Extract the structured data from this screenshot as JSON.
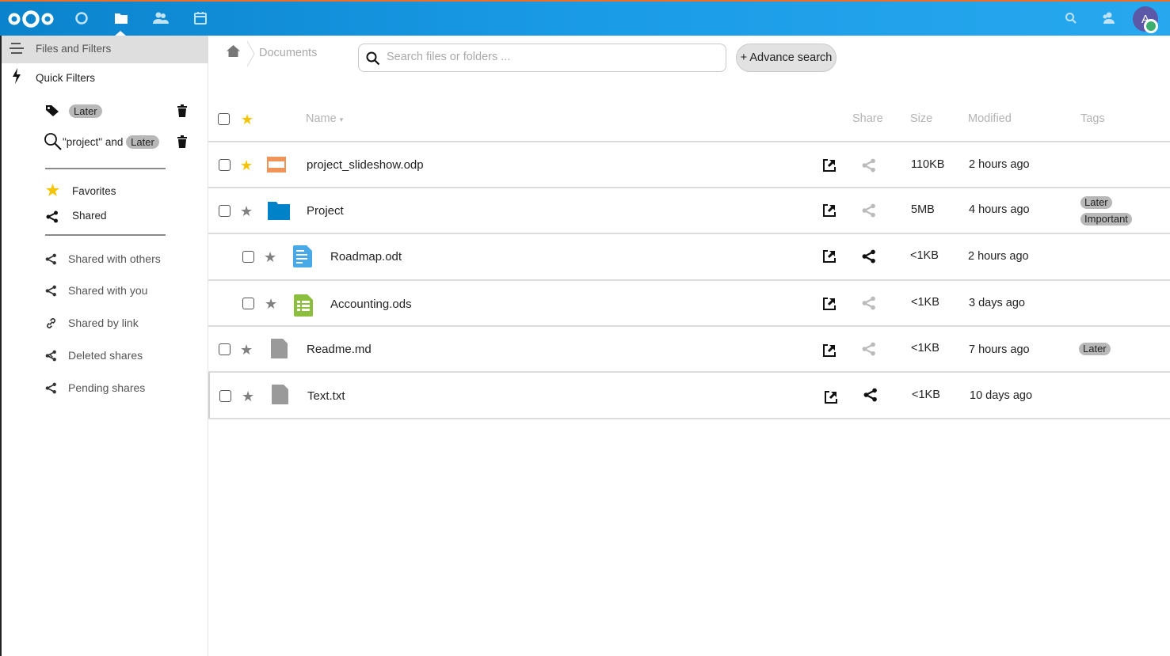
{
  "topbar": {
    "nav": [
      {
        "name": "dashboard",
        "icon": "circle-icon"
      },
      {
        "name": "files",
        "icon": "folder-icon",
        "active": true
      },
      {
        "name": "contacts",
        "icon": "contacts-icon"
      },
      {
        "name": "calendar",
        "icon": "calendar-icon"
      }
    ],
    "right": {
      "search_icon": "search-icon",
      "contacts_icon": "contacts-icon"
    },
    "avatar": {
      "initial": "A",
      "status_color": "#3cae6e",
      "bg": "#5b58a8"
    },
    "accent": "#1a9be6"
  },
  "sidebar": {
    "header_label": "Files and Filters",
    "quick_filters_label": "Quick Filters",
    "quick_filters": [
      {
        "type": "tag",
        "prefix": "",
        "tag": "Later"
      },
      {
        "type": "search",
        "prefix": "\"project\" and",
        "tag": "Later"
      }
    ],
    "favorites_label": "Favorites",
    "shared_label": "Shared",
    "share_items": [
      {
        "label": "Shared with others",
        "icon": "share-icon"
      },
      {
        "label": "Shared with you",
        "icon": "share-icon"
      },
      {
        "label": "Shared by link",
        "icon": "link-icon"
      },
      {
        "label": "Deleted shares",
        "icon": "deleted-share-icon"
      },
      {
        "label": "Pending shares",
        "icon": "share-icon"
      }
    ]
  },
  "breadcrumb": {
    "current": "Documents"
  },
  "search": {
    "placeholder": "Search files or folders ...",
    "value": ""
  },
  "advance_search_label": "+ Advance search",
  "table": {
    "headers": {
      "name": "Name",
      "share": "Share",
      "size": "Size",
      "modified": "Modified",
      "tags": "Tags"
    },
    "rows": [
      {
        "name": "project_slideshow.odp",
        "type": "presentation",
        "favorite": true,
        "indent": false,
        "shared": false,
        "size": "110KB",
        "modified": "2 hours ago",
        "tags": []
      },
      {
        "name": "Project",
        "type": "folder",
        "favorite": false,
        "indent": false,
        "shared": false,
        "size": "5MB",
        "modified": "4 hours ago",
        "tags": [
          "Later",
          "Important"
        ]
      },
      {
        "name": "Roadmap.odt",
        "type": "document",
        "favorite": false,
        "indent": true,
        "shared": true,
        "size": "<1KB",
        "modified": "2 hours ago",
        "tags": []
      },
      {
        "name": "Accounting.ods",
        "type": "spreadsheet",
        "favorite": false,
        "indent": true,
        "shared": false,
        "size": "<1KB",
        "modified": "3 days ago",
        "tags": []
      },
      {
        "name": "Readme.md",
        "type": "file",
        "favorite": false,
        "indent": false,
        "shared": false,
        "size": "<1KB",
        "modified": "7 hours ago",
        "tags": [
          "Later"
        ]
      },
      {
        "name": "Text.txt",
        "type": "file",
        "favorite": false,
        "indent": false,
        "shared": true,
        "size": "<1KB",
        "modified": "10 days ago",
        "tags": []
      }
    ]
  }
}
